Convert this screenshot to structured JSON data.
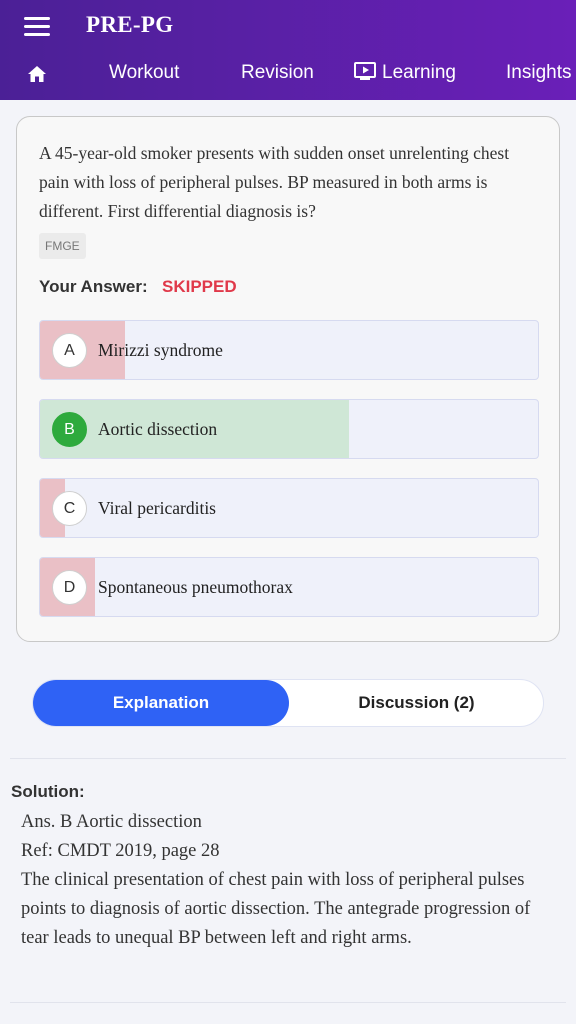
{
  "header": {
    "app_title": "PRE-PG",
    "nav": {
      "home_icon": "home-icon",
      "items": [
        {
          "label": "Workout"
        },
        {
          "label": "Revision"
        },
        {
          "label": "Learning",
          "icon": "play-screen-icon"
        },
        {
          "label": "Insights"
        }
      ]
    },
    "colors": {
      "bar_start": "#4b2096",
      "bar_end": "#6a1fb8"
    }
  },
  "question": {
    "text": "A 45-year-old smoker presents with sudden onset unrelenting chest pain with loss of peripheral pulses. BP measured in both arms is different. First differential diagnosis is?",
    "tag": "FMGE",
    "your_answer_label": "Your Answer:",
    "your_answer_value": "SKIPPED",
    "options": [
      {
        "letter": "A",
        "text": "Mirizzi syndrome",
        "percent": 17,
        "correct": false
      },
      {
        "letter": "B",
        "text": "Aortic dissection",
        "percent": 62,
        "correct": true
      },
      {
        "letter": "C",
        "text": "Viral pericarditis",
        "percent": 5,
        "correct": false
      },
      {
        "letter": "D",
        "text": "Spontaneous pneumothorax",
        "percent": 11,
        "correct": false
      }
    ],
    "colors": {
      "wrong_fill": "#eac0c6",
      "correct_fill": "#cfe7d6",
      "correct_badge": "#2eaa3d",
      "skipped": "#e0394a"
    }
  },
  "tabs": {
    "explanation": "Explanation",
    "discussion": "Discussion (2)",
    "active_color": "#2f62f5"
  },
  "solution": {
    "label": "Solution:",
    "lines": [
      "Ans. B Aortic dissection",
      "Ref: CMDT 2019, page 28",
      "The clinical presentation of chest pain with loss of peripheral pulses points to diagnosis of aortic dissection. The antegrade progression of tear leads to unequal BP between left and right arms."
    ]
  }
}
